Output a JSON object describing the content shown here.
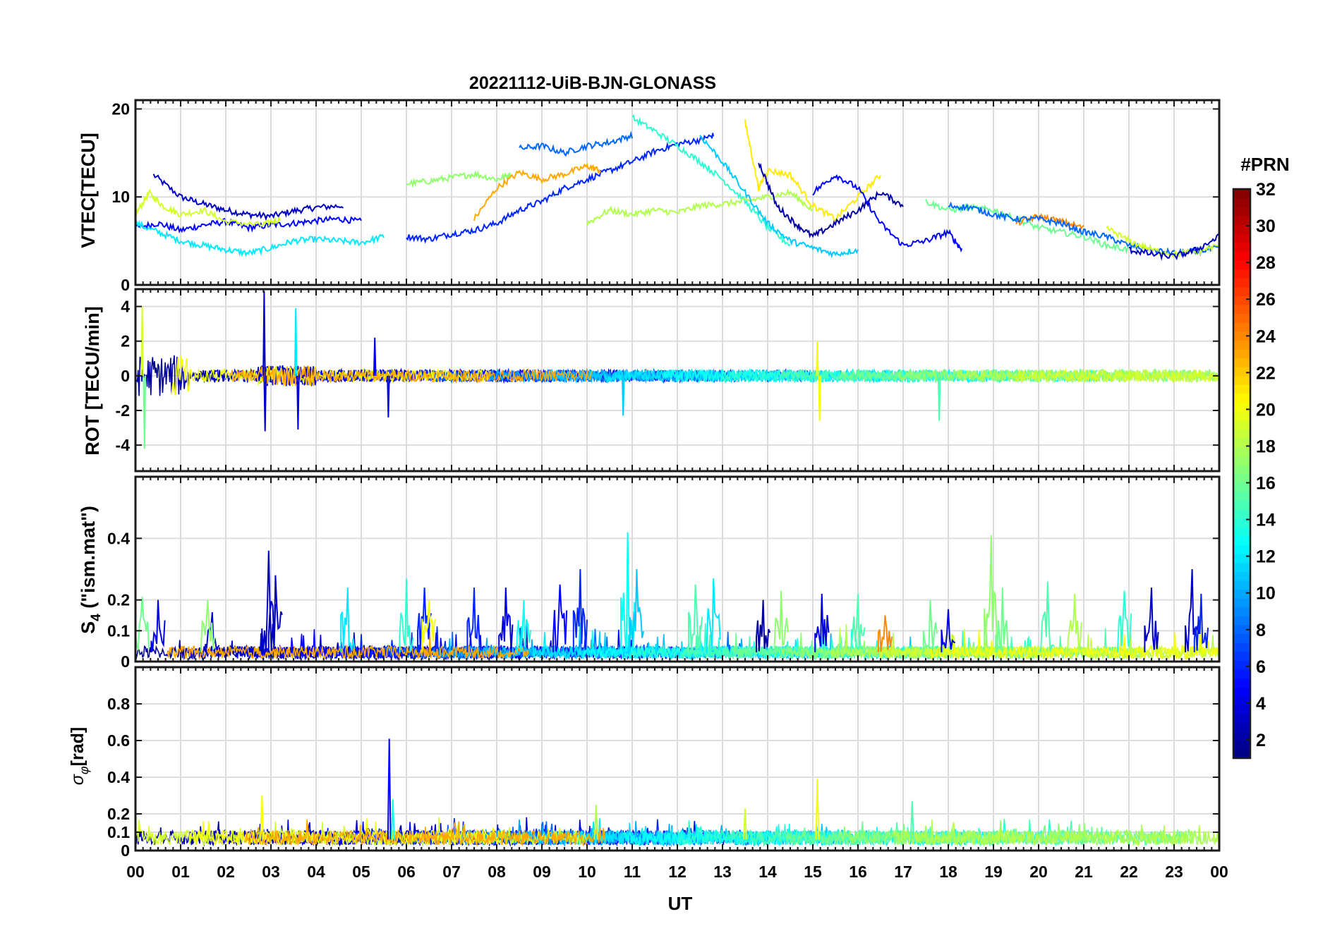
{
  "figure": {
    "title": "20221112-UiB-BJN-GLONASS",
    "xlabel": "UT",
    "x_tick_labels": [
      "00",
      "01",
      "02",
      "03",
      "04",
      "05",
      "06",
      "07",
      "08",
      "09",
      "10",
      "11",
      "12",
      "13",
      "14",
      "15",
      "16",
      "17",
      "18",
      "19",
      "20",
      "21",
      "22",
      "23",
      "00"
    ]
  },
  "colorbar": {
    "label": "#PRN",
    "colormap": "jet",
    "range": [
      1,
      32
    ],
    "tick_labels": [
      "2",
      "4",
      "6",
      "8",
      "10",
      "12",
      "14",
      "16",
      "18",
      "20",
      "22",
      "24",
      "26",
      "28",
      "30",
      "32"
    ]
  },
  "chart_data": [
    {
      "type": "line",
      "panel": "vtec",
      "ylabel": "VTEC[TECU]",
      "ylim": [
        0,
        21
      ],
      "y_ticks": [
        0,
        10,
        20
      ],
      "y_tick_labels": [
        "0",
        "10",
        "20"
      ],
      "x_unit": "hours UT",
      "xlim": [
        0,
        24
      ],
      "grid": true,
      "series": [
        {
          "prn": 3,
          "x": [
            0.4,
            1.0,
            1.5,
            2.0,
            2.5,
            3.0,
            3.5,
            4.0,
            4.6
          ],
          "y": [
            12.5,
            10,
            9.2,
            8.5,
            8,
            7.8,
            8.4,
            8.8,
            9.0
          ]
        },
        {
          "prn": 5,
          "x": [
            0.0,
            0.5,
            1.0,
            1.5,
            2.0,
            2.5,
            3.0,
            3.5,
            4.0,
            4.5,
            5.0
          ],
          "y": [
            6.5,
            7.0,
            6.2,
            6.8,
            7.2,
            6.5,
            6.8,
            7.0,
            7.3,
            7.5,
            7.2
          ]
        },
        {
          "prn": 19,
          "x": [
            0.0,
            0.3,
            0.6,
            1.0,
            1.5,
            2.0,
            2.8,
            3.2
          ],
          "y": [
            8.0,
            10.5,
            9.0,
            8.0,
            8.5,
            7.2,
            6.8,
            7.5
          ]
        },
        {
          "prn": 12,
          "x": [
            0.0,
            0.5,
            1.0,
            1.5,
            2.0,
            2.5,
            3.0,
            3.5,
            4.0,
            4.5,
            5.0,
            5.5
          ],
          "y": [
            7.0,
            6.0,
            5.0,
            4.5,
            4.0,
            3.6,
            4.2,
            5.0,
            5.2,
            5.0,
            4.8,
            5.5
          ]
        },
        {
          "prn": 17,
          "x": [
            6.0,
            6.5,
            7.0,
            7.5,
            8.0,
            8.3
          ],
          "y": [
            11.5,
            11.8,
            12.2,
            12.6,
            12.0,
            12.5
          ]
        },
        {
          "prn": 6,
          "x": [
            6.0,
            6.5,
            7.0,
            7.5,
            8.0,
            8.5,
            9.0,
            9.5,
            10.0,
            10.5,
            11.0,
            11.5,
            12.0,
            12.5,
            12.8
          ],
          "y": [
            5.5,
            5.2,
            5.8,
            6.2,
            7.0,
            8.5,
            9.5,
            11.0,
            12.0,
            13.0,
            14.0,
            15.2,
            16.0,
            16.5,
            17.0
          ]
        },
        {
          "prn": 23,
          "x": [
            7.5,
            8.0,
            8.5,
            9.0,
            9.5,
            10.0,
            10.3
          ],
          "y": [
            7.5,
            11.0,
            12.8,
            12.0,
            12.6,
            13.5,
            13.0
          ]
        },
        {
          "prn": 8,
          "x": [
            8.5,
            9.0,
            9.5,
            10.0,
            10.5,
            11.0
          ],
          "y": [
            15.5,
            15.8,
            15.0,
            15.8,
            16.2,
            17.0
          ]
        },
        {
          "prn": 14,
          "x": [
            11.0,
            11.5,
            12.0,
            12.5,
            13.0,
            13.5,
            14.0,
            14.5
          ],
          "y": [
            19.0,
            17.5,
            15.8,
            14.0,
            12.0,
            9.5,
            6.5,
            4.5
          ]
        },
        {
          "prn": 18,
          "x": [
            10.0,
            10.5,
            11.0,
            11.5,
            12.0,
            12.5,
            13.0,
            13.5,
            14.0,
            14.5,
            15.0
          ],
          "y": [
            7.0,
            8.5,
            8.0,
            8.5,
            8.2,
            9.0,
            9.2,
            9.5,
            10.0,
            10.5,
            8.5
          ]
        },
        {
          "prn": 21,
          "x": [
            13.5,
            13.8,
            14.0,
            14.5,
            15.0,
            15.5,
            16.0,
            16.5
          ],
          "y": [
            18.5,
            11.0,
            13.0,
            12.5,
            9.0,
            7.5,
            10.0,
            12.5
          ]
        },
        {
          "prn": 2,
          "x": [
            13.8,
            14.2,
            14.6,
            15.0,
            15.5,
            16.0,
            16.5,
            17.0
          ],
          "y": [
            14.0,
            9.0,
            7.0,
            5.5,
            7.0,
            8.5,
            10.5,
            9.0
          ]
        },
        {
          "prn": 5,
          "x": [
            15.0,
            15.5,
            16.0,
            16.5,
            17.0,
            17.5,
            18.0,
            18.3
          ],
          "y": [
            10.5,
            12.5,
            11.0,
            7.0,
            4.5,
            5.0,
            6.0,
            4.0
          ]
        },
        {
          "prn": 11,
          "x": [
            12.5,
            13.0,
            13.5,
            14.0,
            14.5,
            15.0,
            15.5,
            16.0
          ],
          "y": [
            17.0,
            14.0,
            10.5,
            7.0,
            5.0,
            4.2,
            3.5,
            4.0
          ]
        },
        {
          "prn": 16,
          "x": [
            17.5,
            18.0,
            18.5,
            19.0,
            19.5,
            20.0,
            20.5,
            21.0,
            21.5,
            22.0
          ],
          "y": [
            9.5,
            8.5,
            8.8,
            8.5,
            7.5,
            6.5,
            6.0,
            5.5,
            4.5,
            4.0
          ]
        },
        {
          "prn": 24,
          "x": [
            19.5,
            20.0,
            20.5,
            21.0
          ],
          "y": [
            7.0,
            7.8,
            7.2,
            6.5
          ]
        },
        {
          "prn": 8,
          "x": [
            18.0,
            18.5,
            19.0,
            19.5,
            20.0,
            20.5,
            21.0,
            21.5,
            22.0,
            22.5,
            23.0,
            23.5,
            24.0
          ],
          "y": [
            9.0,
            8.8,
            8.0,
            7.5,
            7.5,
            7.0,
            6.0,
            5.5,
            4.5,
            4.0,
            3.6,
            3.8,
            4.2
          ]
        },
        {
          "prn": 19,
          "x": [
            21.5,
            22.0,
            22.5,
            23.0,
            23.5,
            24.0
          ],
          "y": [
            6.5,
            5.0,
            4.0,
            3.5,
            3.8,
            4.5
          ]
        },
        {
          "prn": 3,
          "x": [
            22.0,
            22.5,
            23.0,
            23.5,
            24.0
          ],
          "y": [
            4.0,
            3.5,
            3.2,
            4.0,
            5.5
          ]
        }
      ]
    },
    {
      "type": "line",
      "panel": "rot",
      "ylabel": "ROT [TECU/min]",
      "ylim": [
        -5.5,
        5.0
      ],
      "y_ticks": [
        -4,
        -2,
        0,
        2,
        4
      ],
      "y_tick_labels": [
        "-4",
        "-2",
        "0",
        "2",
        "4"
      ],
      "x_unit": "hours UT",
      "xlim": [
        0,
        24
      ],
      "grid": true,
      "spikes": [
        {
          "prn": 19,
          "x": 0.15,
          "y": 4.0
        },
        {
          "prn": 16,
          "x": 0.2,
          "y": -4.2
        },
        {
          "prn": 3,
          "x": 2.85,
          "y": 4.9
        },
        {
          "prn": 3,
          "x": 2.87,
          "y": -3.2
        },
        {
          "prn": 12,
          "x": 3.55,
          "y": 3.9
        },
        {
          "prn": 4,
          "x": 3.6,
          "y": -3.1
        },
        {
          "prn": 4,
          "x": 5.3,
          "y": 2.2
        },
        {
          "prn": 4,
          "x": 5.6,
          "y": -2.4
        },
        {
          "prn": 11,
          "x": 10.8,
          "y": -2.3
        },
        {
          "prn": 20,
          "x": 15.1,
          "y": 2.0
        },
        {
          "prn": 20,
          "x": 15.15,
          "y": -2.6
        },
        {
          "prn": 15,
          "x": 17.8,
          "y": -2.6
        }
      ]
    },
    {
      "type": "line",
      "panel": "s4",
      "ylabel": "S4 (\"ism.mat\")",
      "ylabel_main": "S",
      "ylabel_sub": "4",
      "ylabel_rest": " (\"ism.mat\")",
      "ylim": [
        0,
        0.6
      ],
      "y_ticks": [
        0,
        0.1,
        0.2,
        0.4
      ],
      "y_tick_labels": [
        "0",
        "0.1",
        "0.2",
        "0.4"
      ],
      "x_unit": "hours UT",
      "xlim": [
        0,
        24
      ],
      "grid": true,
      "spikes": [
        {
          "prn": 16,
          "x": 0.15,
          "y": 0.21
        },
        {
          "prn": 4,
          "x": 0.5,
          "y": 0.2
        },
        {
          "prn": 4,
          "x": 1.7,
          "y": 0.16
        },
        {
          "prn": 17,
          "x": 1.6,
          "y": 0.2
        },
        {
          "prn": 3,
          "x": 2.95,
          "y": 0.36
        },
        {
          "prn": 3,
          "x": 3.1,
          "y": 0.28
        },
        {
          "prn": 12,
          "x": 4.7,
          "y": 0.24
        },
        {
          "prn": 14,
          "x": 6.0,
          "y": 0.27
        },
        {
          "prn": 6,
          "x": 6.4,
          "y": 0.24
        },
        {
          "prn": 20,
          "x": 6.5,
          "y": 0.2
        },
        {
          "prn": 6,
          "x": 7.5,
          "y": 0.24
        },
        {
          "prn": 4,
          "x": 8.2,
          "y": 0.24
        },
        {
          "prn": 13,
          "x": 8.6,
          "y": 0.2
        },
        {
          "prn": 5,
          "x": 9.4,
          "y": 0.25
        },
        {
          "prn": 6,
          "x": 9.85,
          "y": 0.3
        },
        {
          "prn": 13,
          "x": 10.9,
          "y": 0.42
        },
        {
          "prn": 11,
          "x": 11.1,
          "y": 0.3
        },
        {
          "prn": 15,
          "x": 12.4,
          "y": 0.25
        },
        {
          "prn": 12,
          "x": 12.8,
          "y": 0.27
        },
        {
          "prn": 2,
          "x": 13.9,
          "y": 0.2
        },
        {
          "prn": 17,
          "x": 14.3,
          "y": 0.23
        },
        {
          "prn": 4,
          "x": 15.2,
          "y": 0.22
        },
        {
          "prn": 15,
          "x": 16.0,
          "y": 0.22
        },
        {
          "prn": 24,
          "x": 16.6,
          "y": 0.15
        },
        {
          "prn": 16,
          "x": 17.6,
          "y": 0.2
        },
        {
          "prn": 4,
          "x": 18.0,
          "y": 0.17
        },
        {
          "prn": 17,
          "x": 18.95,
          "y": 0.41
        },
        {
          "prn": 16,
          "x": 19.2,
          "y": 0.24
        },
        {
          "prn": 15,
          "x": 20.2,
          "y": 0.26
        },
        {
          "prn": 18,
          "x": 20.8,
          "y": 0.22
        },
        {
          "prn": 14,
          "x": 21.9,
          "y": 0.23
        },
        {
          "prn": 3,
          "x": 22.5,
          "y": 0.24
        },
        {
          "prn": 3,
          "x": 23.4,
          "y": 0.3
        },
        {
          "prn": 6,
          "x": 23.6,
          "y": 0.22
        }
      ]
    },
    {
      "type": "line",
      "panel": "sigma_phi",
      "ylabel": "σφ[rad]",
      "ylabel_main": "σ",
      "ylabel_sub": "φ",
      "ylabel_rest": "[rad]",
      "ylim": [
        0,
        1.0
      ],
      "y_ticks": [
        0,
        0.1,
        0.2,
        0.4,
        0.6,
        0.8
      ],
      "y_tick_labels": [
        "0",
        "0.1",
        "0.2",
        "0.4",
        "0.6",
        "0.8"
      ],
      "x_unit": "hours UT",
      "xlim": [
        0,
        24
      ],
      "grid": true,
      "spikes": [
        {
          "prn": 20,
          "x": 2.8,
          "y": 0.3
        },
        {
          "prn": 5,
          "x": 5.62,
          "y": 0.61
        },
        {
          "prn": 13,
          "x": 5.7,
          "y": 0.28
        },
        {
          "prn": 18,
          "x": 10.2,
          "y": 0.25
        },
        {
          "prn": 19,
          "x": 13.5,
          "y": 0.23
        },
        {
          "prn": 20,
          "x": 15.1,
          "y": 0.39
        },
        {
          "prn": 15,
          "x": 17.2,
          "y": 0.27
        }
      ]
    }
  ]
}
